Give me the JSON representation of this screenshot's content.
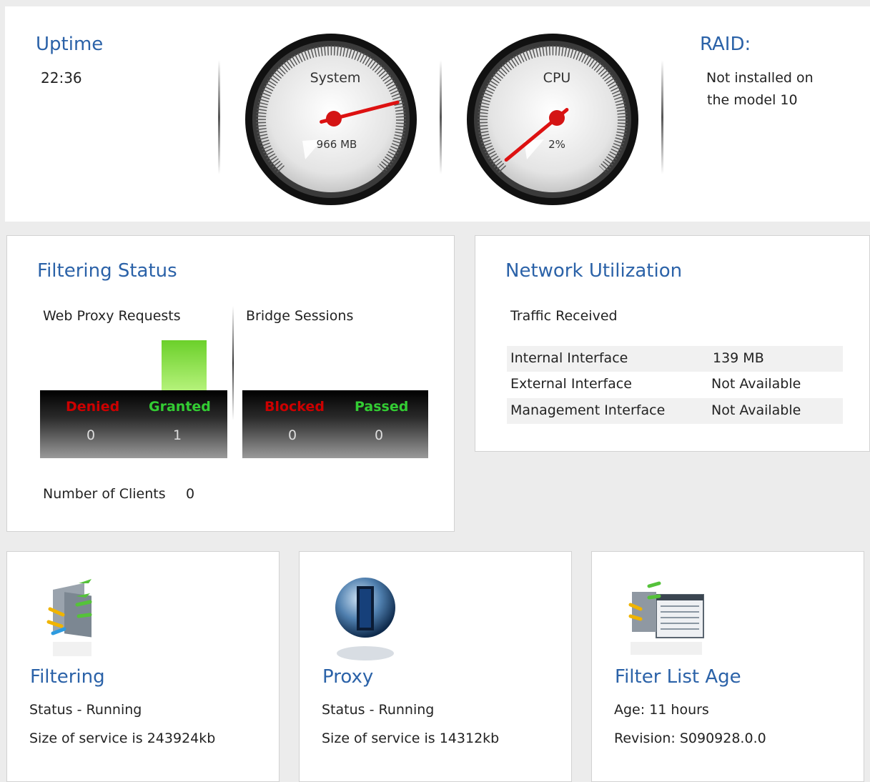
{
  "uptime": {
    "title": "Uptime",
    "value": "22:36"
  },
  "system_gauge": {
    "label": "System",
    "readout": "966 MB",
    "level": 0.78
  },
  "cpu_gauge": {
    "label": "CPU",
    "readout": "2%",
    "level": 0.02
  },
  "raid": {
    "title": "RAID:",
    "line1": "Not installed on",
    "line2": "the model 10"
  },
  "filtering_status": {
    "title": "Filtering Status",
    "web_proxy": {
      "label": "Web Proxy Requests",
      "denied_label": "Denied",
      "denied_value": "0",
      "granted_label": "Granted",
      "granted_value": "1"
    },
    "bridge": {
      "label": "Bridge Sessions",
      "blocked_label": "Blocked",
      "blocked_value": "0",
      "passed_label": "Passed",
      "passed_value": "0"
    },
    "clients_label": "Number of Clients",
    "clients_value": "0"
  },
  "network": {
    "title": "Network Utilization",
    "subtitle": "Traffic Received",
    "rows": [
      {
        "name": "Internal Interface",
        "value": "139 MB"
      },
      {
        "name": "External Interface",
        "value": "Not Available"
      },
      {
        "name": "Management Interface",
        "value": "Not Available"
      }
    ]
  },
  "services": [
    {
      "title": "Filtering",
      "line1": "Status - Running",
      "line2": "Size of service is 243924kb",
      "icon": "filtering-icon"
    },
    {
      "title": "Proxy",
      "line1": "Status - Running",
      "line2": "Size of service is 14312kb",
      "icon": "proxy-globe-icon"
    },
    {
      "title": "Filter List Age",
      "line1": "Age: 11 hours",
      "line2": "Revision: S090928.0.0",
      "icon": "filter-list-icon"
    }
  ],
  "colors": {
    "title_blue": "#2b62a8",
    "denied_red": "#cc0000",
    "granted_green": "#33cc33",
    "needle_red": "#dd1111"
  }
}
